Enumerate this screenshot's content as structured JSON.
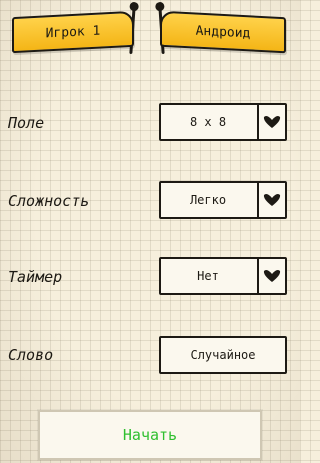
{
  "players": {
    "left": "Игрок 1",
    "right": "Андроид"
  },
  "settings": {
    "field": {
      "label": "Поле",
      "value": "8 x 8"
    },
    "difficulty": {
      "label": "Сложность",
      "value": "Легко"
    },
    "timer": {
      "label": "Таймер",
      "value": "Нет"
    },
    "word": {
      "label": "Слово",
      "value": "Случайное"
    }
  },
  "start_label": "Начать",
  "colors": {
    "banner": "#f4b516",
    "start_text": "#2fbf2f",
    "ink": "#1d1a14",
    "paper": "#f6efdc"
  },
  "icons": {
    "dropdown": "heart-chevron-icon"
  }
}
